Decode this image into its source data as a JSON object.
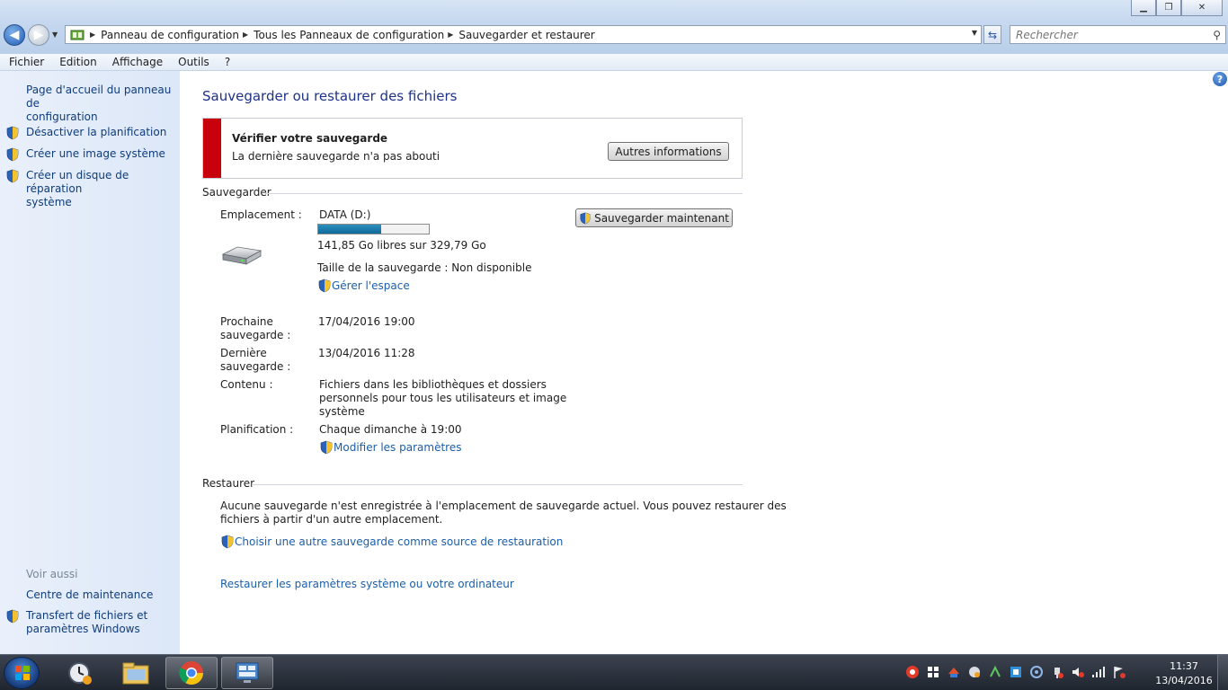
{
  "window": {
    "controls": {
      "minimize": "▁",
      "maximize": "❐",
      "close": "✕"
    }
  },
  "address": {
    "crumbs": [
      "Panneau de configuration",
      "Tous les Panneaux de configuration",
      "Sauvegarder et restaurer"
    ],
    "search_placeholder": "Rechercher"
  },
  "menu": {
    "items": [
      "Fichier",
      "Edition",
      "Affichage",
      "Outils",
      "?"
    ]
  },
  "left_pane": {
    "home_link": [
      "Page d'accueil du panneau de",
      "configuration"
    ],
    "tasks": [
      {
        "label": [
          "Désactiver la planification"
        ]
      },
      {
        "label": [
          "Créer une image système"
        ]
      },
      {
        "label": [
          "Créer un disque de réparation",
          "système"
        ]
      }
    ],
    "see_also_heading": "Voir aussi",
    "see_also": [
      {
        "label": [
          "Centre de maintenance"
        ]
      },
      {
        "label": [
          "Transfert de fichiers et",
          "paramètres Windows"
        ]
      }
    ]
  },
  "main": {
    "title": "Sauvegarder ou restaurer des fichiers",
    "alert": {
      "title": "Vérifier votre sauvegarde",
      "text": "La dernière sauvegarde n'a pas abouti",
      "button": "Autres informations",
      "color": "#c8000c"
    },
    "backup": {
      "heading": "Sauvegarder",
      "location_label": "Emplacement :",
      "location_value": "DATA (D:)",
      "disk_used_fraction": 0.57,
      "free_space": "141,85 Go libres sur 329,79 Go",
      "size_text": "Taille de la sauvegarde : Non disponible",
      "manage_link": "Gérer l'espace",
      "backup_now_button": "Sauvegarder maintenant",
      "next_label": [
        "Prochaine",
        "sauvegarde :"
      ],
      "next_value": "17/04/2016 19:00",
      "last_label": [
        "Dernière",
        "sauvegarde :"
      ],
      "last_value": "13/04/2016 11:28",
      "contents_label": "Contenu :",
      "contents_value": [
        "Fichiers dans les bibliothèques et dossiers",
        "personnels pour tous les utilisateurs et image",
        "système"
      ],
      "schedule_label": "Planification :",
      "schedule_value": "Chaque dimanche à 19:00",
      "change_settings_link": "Modifier les paramètres"
    },
    "restore": {
      "heading": "Restaurer",
      "text": [
        "Aucune sauvegarde n'est enregistrée à l'emplacement de sauvegarde actuel. Vous pouvez restaurer des",
        "fichiers à partir d'un autre emplacement."
      ],
      "choose_link": "Choisir une autre sauvegarde comme source de restauration",
      "system_link": "Restaurer les paramètres système ou votre ordinateur"
    }
  },
  "taskbar": {
    "time": "11:37",
    "date": "13/04/2016"
  }
}
